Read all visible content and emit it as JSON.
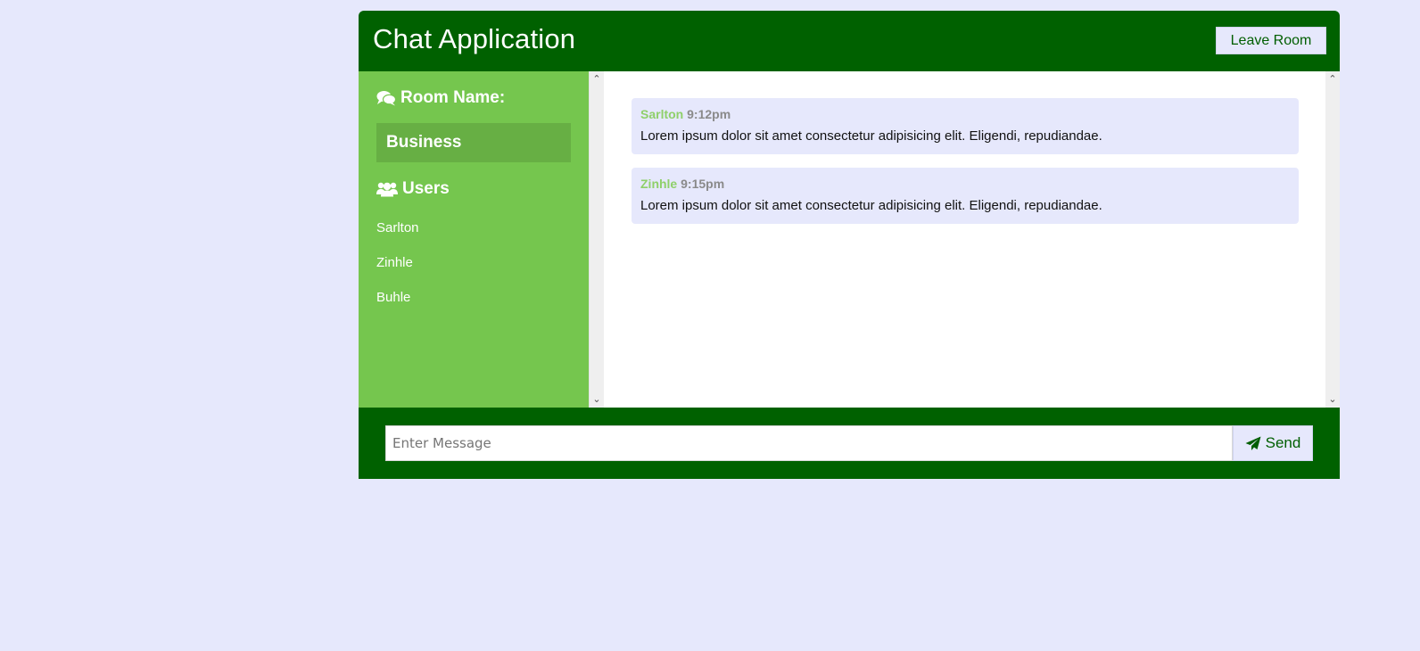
{
  "header": {
    "title": "Chat Application",
    "leave_label": "Leave Room"
  },
  "sidebar": {
    "room_heading": "Room Name:",
    "room_heading_icon": "comments-icon",
    "room_name": "Business",
    "users_heading": "Users",
    "users_heading_icon": "users-icon",
    "users": [
      "Sarlton",
      "Zinhle",
      "Buhle"
    ]
  },
  "messages": [
    {
      "author": "Sarlton",
      "time": "9:12pm",
      "text": "Lorem ipsum dolor sit amet consectetur adipisicing elit. Eligendi, repudiandae."
    },
    {
      "author": "Zinhle",
      "time": "9:15pm",
      "text": "Lorem ipsum dolor sit amet consectetur adipisicing elit. Eligendi, repudiandae."
    }
  ],
  "form": {
    "placeholder": "Enter Message",
    "value": "",
    "send_label": "Send",
    "send_icon": "paper-plane-icon"
  },
  "colors": {
    "page_background": "#e6e8fc",
    "header_dark_green": "#006100",
    "sidebar_green": "#75c64e",
    "room_box_green": "#67af44",
    "author_green": "#8fd06a",
    "time_gray": "#8a8a8a"
  }
}
